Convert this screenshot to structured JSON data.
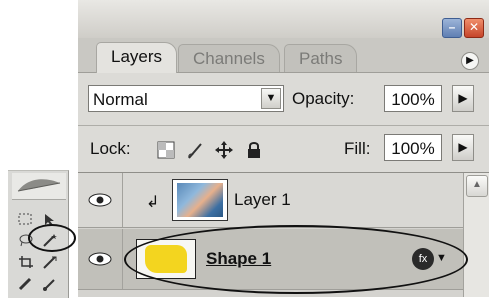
{
  "panel": {
    "tabs": [
      {
        "label": "Layers",
        "active": true
      },
      {
        "label": "Channels",
        "active": false
      },
      {
        "label": "Paths",
        "active": false
      }
    ],
    "blend_mode": "Normal",
    "opacity_label": "Opacity:",
    "opacity_value": "100%",
    "lock_label": "Lock:",
    "fill_label": "Fill:",
    "fill_value": "100%"
  },
  "layers": [
    {
      "name": "Layer 1",
      "visible": true,
      "clipped": true,
      "underlined": false
    },
    {
      "name": "Shape 1",
      "visible": true,
      "selected": true,
      "underlined": true,
      "has_effects": true
    }
  ],
  "icons": [
    "minimize-icon",
    "close-icon",
    "panel-menu-icon",
    "lock-transparent-icon",
    "lock-brush-icon",
    "lock-move-icon",
    "lock-all-icon",
    "eye-icon",
    "layer-effects-icon",
    "scroll-up-icon"
  ],
  "colors": {
    "shape_fill": "#f3d51f",
    "close_button": "#c5452a",
    "minimize_button": "#5f7fb3"
  }
}
